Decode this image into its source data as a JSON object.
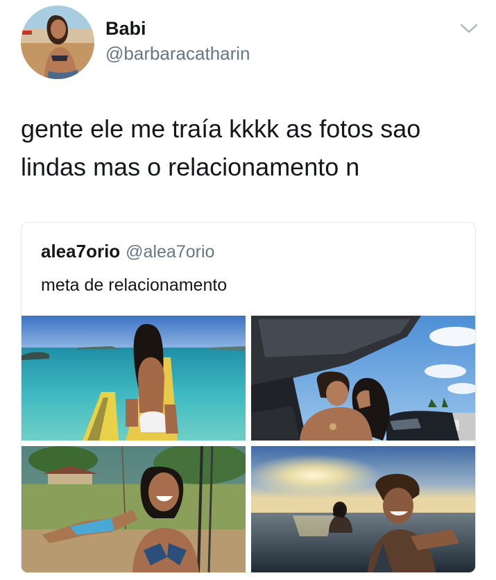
{
  "author": {
    "name": "Babi",
    "handle": "@barbaracatharin"
  },
  "tweet": {
    "lines": [
      "gente ele me traía kkkk as fotos sao",
      "lindas mas o relacionamento n"
    ]
  },
  "quoted_tweet": {
    "name": "alea7orio",
    "handle": "@alea7orio",
    "text": "meta de relacionamento",
    "photos": [
      {
        "name": "photo-paddleboard-sea"
      },
      {
        "name": "photo-couple-car-kiss"
      },
      {
        "name": "photo-swing-smile"
      },
      {
        "name": "photo-sunset-ocean-selfie"
      }
    ]
  },
  "icons": {
    "menu": "chevron-down-icon"
  },
  "colors": {
    "text_primary": "#14171a",
    "text_secondary": "#657786",
    "border": "#e1e8ed"
  }
}
